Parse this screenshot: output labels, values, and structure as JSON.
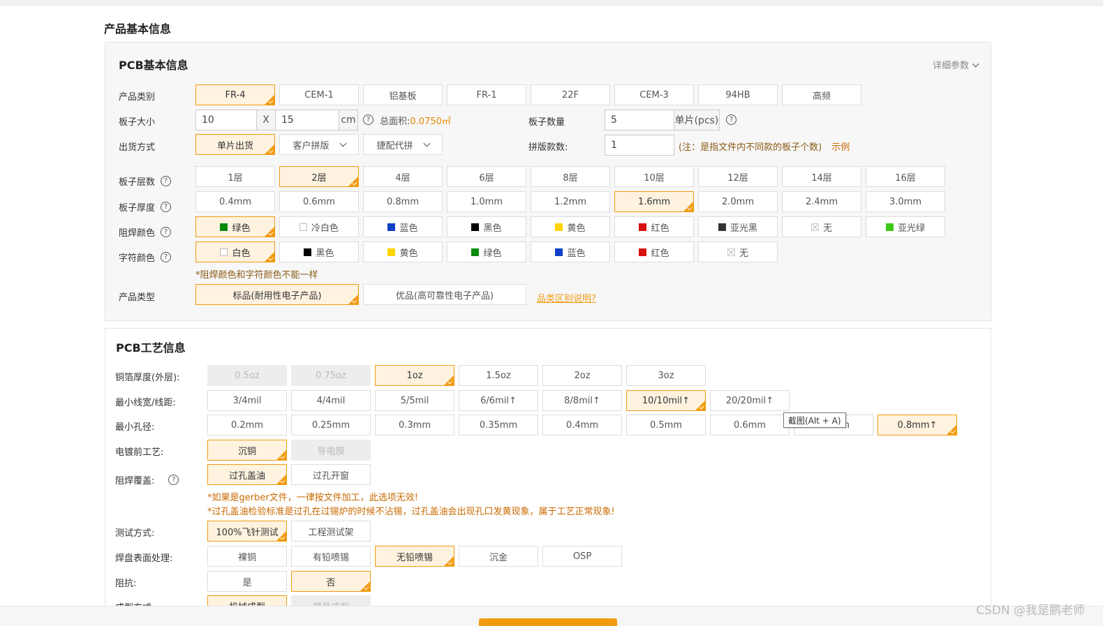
{
  "section_title": "产品基本信息",
  "basic": {
    "title": "PCB基本信息",
    "detail_link": "详细参数",
    "product_category": {
      "label": "产品类别",
      "options": [
        "FR-4",
        "CEM-1",
        "铝基板",
        "FR-1",
        "22F",
        "CEM-3",
        "94HB",
        "高频"
      ],
      "selected": 0
    },
    "board_size": {
      "label": "板子大小",
      "width": "10",
      "times": "X",
      "height": "15",
      "unit": "cm",
      "area_label": "总面积:",
      "area_value": "0.0750㎡"
    },
    "board_qty": {
      "label": "板子数量",
      "value": "5",
      "unit": "单片(pcs)"
    },
    "ship_mode": {
      "label": "出货方式",
      "options": [
        "单片出货",
        "客户拼版",
        "捷配代拼"
      ],
      "selected": 0
    },
    "panel_count": {
      "label": "拼版款数:",
      "value": "1",
      "note": "(注：是指文件内不同款的板子个数)",
      "example": "示例"
    },
    "layers": {
      "label": "板子层数",
      "options": [
        "1层",
        "2层",
        "4层",
        "6层",
        "8层",
        "10层",
        "12层",
        "14层",
        "16层"
      ],
      "selected": 1
    },
    "thickness": {
      "label": "板子厚度",
      "options": [
        "0.4mm",
        "0.6mm",
        "0.8mm",
        "1.0mm",
        "1.2mm",
        "1.6mm",
        "2.0mm",
        "2.4mm",
        "3.0mm"
      ],
      "selected": 5
    },
    "mask_color": {
      "label": "阻焊颜色",
      "options": [
        {
          "text": "绿色",
          "color": "#0a8a0a"
        },
        {
          "text": "冷白色",
          "color": "outline"
        },
        {
          "text": "蓝色",
          "color": "#1040c8"
        },
        {
          "text": "黑色",
          "color": "#000000"
        },
        {
          "text": "黄色",
          "color": "#ffd400"
        },
        {
          "text": "红色",
          "color": "#d81010"
        },
        {
          "text": "亚光黑",
          "color": "#333333"
        },
        {
          "text": "无",
          "color": "none"
        },
        {
          "text": "亚光绿",
          "color": "#3ec81a"
        }
      ],
      "selected": 0
    },
    "silk_color": {
      "label": "字符颜色",
      "options": [
        {
          "text": "白色",
          "color": "outline"
        },
        {
          "text": "黑色",
          "color": "#000000"
        },
        {
          "text": "黄色",
          "color": "#ffd400"
        },
        {
          "text": "绿色",
          "color": "#0a8a0a"
        },
        {
          "text": "蓝色",
          "color": "#1040c8"
        },
        {
          "text": "红色",
          "color": "#d81010"
        },
        {
          "text": "无",
          "color": "none"
        }
      ],
      "selected": 0
    },
    "color_note": "*阻焊颜色和字符颜色不能一样",
    "product_type": {
      "label": "产品类型",
      "options": [
        "标品(耐用性电子产品)",
        "优品(高可靠性电子产品)"
      ],
      "selected": 0,
      "link": "品类区别说明?"
    }
  },
  "tech": {
    "title": "PCB工艺信息",
    "copper": {
      "label": "铜箔厚度(外层):",
      "options": [
        "0.5oz",
        "0.75oz",
        "1oz",
        "1.5oz",
        "2oz",
        "3oz"
      ],
      "disabled": [
        0,
        1
      ],
      "selected": 2
    },
    "trace": {
      "label": "最小线宽/线距:",
      "options": [
        "3/4mil",
        "4/4mil",
        "5/5mil",
        "6/6mil↑",
        "8/8mil↑",
        "10/10mil↑",
        "20/20mil↑"
      ],
      "selected": 5
    },
    "hole": {
      "label": "最小孔径:",
      "options": [
        "0.2mm",
        "0.25mm",
        "0.3mm",
        "0.35mm",
        "0.4mm",
        "0.5mm",
        "0.6mm",
        "0.7mm",
        "0.8mm↑"
      ],
      "selected": 8
    },
    "pre_plating": {
      "label": "电镀前工艺:",
      "options": [
        "沉铜",
        "导电膜"
      ],
      "disabled": [
        1
      ],
      "selected": 0
    },
    "via_cover": {
      "label": "阻焊覆盖:",
      "options": [
        "过孔盖油",
        "过孔开窗"
      ],
      "selected": 0
    },
    "note1": "*如果是gerber文件，一律按文件加工，此选项无效!",
    "note2": "*过孔盖油检验标准是过孔在过锡炉的时候不沾锡，过孔盖油会出现孔口发黄现象，属于工艺正常现象!",
    "test": {
      "label": "测试方式:",
      "options": [
        "100%飞针测试",
        "工程测试架"
      ],
      "selected": 0
    },
    "surface": {
      "label": "焊盘表面处理:",
      "options": [
        "裸铜",
        "有铅喷锡",
        "无铅喷锡",
        "沉金",
        "OSP"
      ],
      "selected": 2
    },
    "impedance": {
      "label": "阻抗:",
      "options": [
        "是",
        "否"
      ],
      "selected": 1
    },
    "forming": {
      "label": "成型方式:",
      "options": [
        "机械成型",
        "模具成型"
      ],
      "disabled": [
        1
      ],
      "selected": 0
    }
  },
  "tooltip": "截图(Alt + A)",
  "watermark": "CSDN @我是鹏老师",
  "colors": {
    "accent": "#f29b11",
    "selected_bg": "#fff3e0",
    "panel_bg": "#f7f7f7"
  }
}
